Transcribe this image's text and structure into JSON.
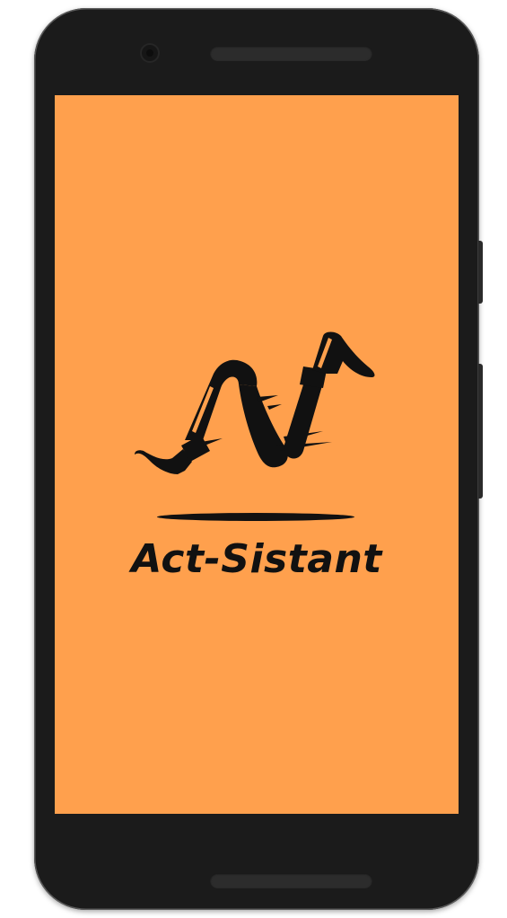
{
  "app": {
    "name": "Act-Sistant"
  },
  "colors": {
    "splash_background": "#ffa04d",
    "logo": "#111111",
    "device_frame": "#1b1b1b"
  },
  "icons": {
    "logo": "running-legs-icon"
  }
}
